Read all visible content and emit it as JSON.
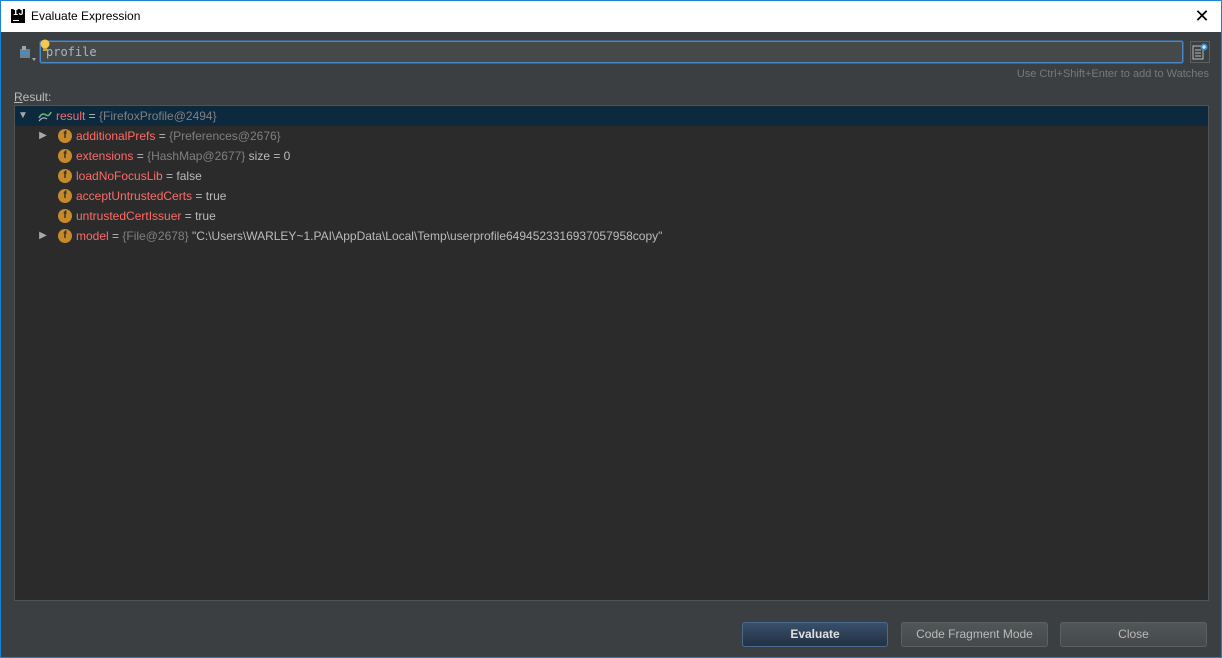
{
  "window": {
    "title": "Evaluate Expression",
    "close_glyph": "✕",
    "app_icon_text": "IJ"
  },
  "expression": {
    "value": "profile",
    "hint": "Use Ctrl+Shift+Enter to add to Watches"
  },
  "result_label": {
    "mnemonic": "R",
    "rest": "esult:"
  },
  "tree": {
    "root": {
      "arrow": "▼",
      "name": "result",
      "eq": " = ",
      "ref": "{FirefoxProfile@2494}"
    },
    "children": [
      {
        "arrow": "▶",
        "icon": "f",
        "name": "additionalPrefs",
        "eq": " = ",
        "ref": "{Preferences@2676}",
        "value": ""
      },
      {
        "arrow": "",
        "icon": "f",
        "name": "extensions",
        "eq": " = ",
        "ref": "{HashMap@2677}",
        "value": "  size = 0"
      },
      {
        "arrow": "",
        "icon": "f",
        "name": "loadNoFocusLib",
        "eq": " = ",
        "ref": "",
        "value": "false"
      },
      {
        "arrow": "",
        "icon": "f",
        "name": "acceptUntrustedCerts",
        "eq": " = ",
        "ref": "",
        "value": "true"
      },
      {
        "arrow": "",
        "icon": "f",
        "name": "untrustedCertIssuer",
        "eq": " = ",
        "ref": "",
        "value": "true"
      },
      {
        "arrow": "▶",
        "icon": "f",
        "name": "model",
        "eq": " = ",
        "ref": "{File@2678}",
        "value": " \"C:\\Users\\WARLEY~1.PAI\\AppData\\Local\\Temp\\userprofile6494523316937057958copy\""
      }
    ]
  },
  "buttons": {
    "evaluate": "Evaluate",
    "code_fragment": "Code Fragment Mode",
    "close": "Close"
  },
  "colors": {
    "background": "#3c3f41",
    "tree_background": "#2b2b2b",
    "selection": "#0d293e",
    "field_name": "#ff6b68",
    "field_icon": "#c68a2d",
    "focus_border": "#4a88c7"
  },
  "icons": {
    "history": "history-dropdown-icon",
    "bulb": "lightbulb-icon",
    "watch": "add-to-watches-icon",
    "result": "watch-result-icon",
    "field": "field-icon"
  }
}
